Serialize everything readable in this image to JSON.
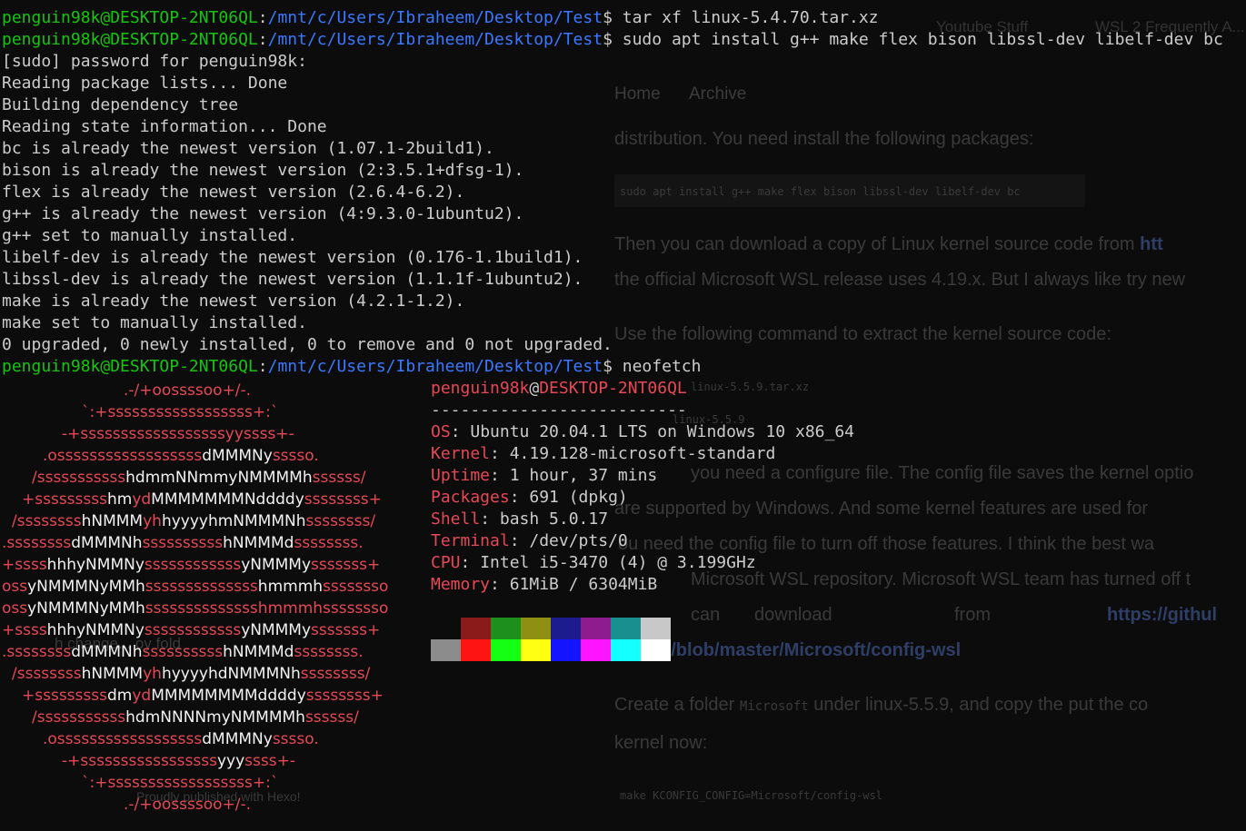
{
  "background_page": {
    "bookmarks": [
      "Youtube Stuff",
      "WSL 2 Frequently A..."
    ],
    "nav": [
      "Home",
      "Archive"
    ],
    "para1": "distribution. You need install the following packages:",
    "code1": "sudo apt install g++ make flex bison libssl-dev libelf-dev bc",
    "para2a": "Then you can download a copy of Linux kernel source code from",
    "para2a_link": "htt",
    "para2b": "the official Microsoft WSL release uses 4.19.x. But I always like try new",
    "para3": "Use the following command to extract the kernel source code:",
    "code2": "linux-5.5.9.tar.xz",
    "code3": "linux-5.5.9",
    "para4a": "you need a configure file. The config file saves the kernel optio",
    "para4b": "are supported by Windows. And some kernel features are used for",
    "para4c": "ou need the config file to turn off those features. I think the best wa",
    "para4d": "Microsoft WSL repository. Microsoft WSL team has turned off t",
    "para4e_1": "can",
    "para4e_2": "download",
    "para4e_3": "from",
    "para4e_4": "https://githul",
    "para4f": "Kernel/blob/master/Microsoft/config-wsl",
    "para5a": "Create a folder",
    "para5a_code": "Microsoft",
    "para5a_rest": "under linux-5.5.9, and copy the put the co",
    "para5b": "kernel now:",
    "code4": "make KCONFIG_CONFIG=Microsoft/config-wsl",
    "footer_left": "h change... oy fold",
    "footer": "Proudly published with Hexo!"
  },
  "terminal": {
    "prompt_user": "penguin98k@DESKTOP-2NT06QL",
    "prompt_path": "/mnt/c/Users/Ibraheem/Desktop/Test",
    "cmd1": " tar xf linux-5.4.70.tar.xz",
    "cmd2": " sudo apt install g++ make flex bison libssl-dev libelf-dev bc",
    "output": [
      "[sudo] password for penguin98k:",
      "Reading package lists... Done",
      "Building dependency tree",
      "Reading state information... Done",
      "bc is already the newest version (1.07.1-2build1).",
      "bison is already the newest version (2:3.5.1+dfsg-1).",
      "flex is already the newest version (2.6.4-6.2).",
      "g++ is already the newest version (4:9.3.0-1ubuntu2).",
      "g++ set to manually installed.",
      "libelf-dev is already the newest version (0.176-1.1build1).",
      "libssl-dev is already the newest version (1.1.1f-1ubuntu2).",
      "make is already the newest version (4.2.1-1.2).",
      "make set to manually installed.",
      "0 upgraded, 0 newly installed, 0 to remove and 0 not upgraded."
    ],
    "cmd3": " neofetch"
  },
  "neofetch": {
    "host_user": "penguin98k",
    "host_at": "@",
    "host_name": "DESKTOP-2NT06QL",
    "separator": "--------------------------",
    "info": [
      {
        "key": "OS",
        "value": ": Ubuntu 20.04.1 LTS on Windows 10 x86_64"
      },
      {
        "key": "Kernel",
        "value": ": 4.19.128-microsoft-standard"
      },
      {
        "key": "Uptime",
        "value": ": 1 hour, 37 mins"
      },
      {
        "key": "Packages",
        "value": ": 691 (dpkg)"
      },
      {
        "key": "Shell",
        "value": ": bash 5.0.17"
      },
      {
        "key": "Terminal",
        "value": ": /dev/pts/0"
      },
      {
        "key": "CPU",
        "value": ": Intel i5-3470 (4) @ 3.199GHz"
      },
      {
        "key": "Memory",
        "value": ": 61MiB / 6304MiB"
      }
    ],
    "logo": [
      [
        {
          "t": ".-/+oossssoo+/-.",
          "c": "r"
        }
      ],
      [
        {
          "t": "`:+ssssssssssssssssss+:`",
          "c": "r"
        }
      ],
      [
        {
          "t": "-+ssssssssssssssssssyyssss+-",
          "c": "r"
        }
      ],
      [
        {
          "t": ".ossssssssssssssssss",
          "c": "r"
        },
        {
          "t": "dMMMNy",
          "c": "w"
        },
        {
          "t": "sssso.",
          "c": "r"
        }
      ],
      [
        {
          "t": "/sssssssssss",
          "c": "r"
        },
        {
          "t": "hdmmNNmmyNMMMMh",
          "c": "w"
        },
        {
          "t": "ssssss/",
          "c": "r"
        }
      ],
      [
        {
          "t": "+sssssssss",
          "c": "r"
        },
        {
          "t": "hm",
          "c": "w"
        },
        {
          "t": "yd",
          "c": "r"
        },
        {
          "t": "MMMMMMMNddddy",
          "c": "w"
        },
        {
          "t": "ssssssss+",
          "c": "r"
        }
      ],
      [
        {
          "t": "/ssssssss",
          "c": "r"
        },
        {
          "t": "hNMMM",
          "c": "w"
        },
        {
          "t": "yh",
          "c": "r"
        },
        {
          "t": "hyyyyhmNMMMNh",
          "c": "w"
        },
        {
          "t": "ssssssss/",
          "c": "r"
        }
      ],
      [
        {
          "t": ".ssssssss",
          "c": "r"
        },
        {
          "t": "dMMMNh",
          "c": "w"
        },
        {
          "t": "ssssssssss",
          "c": "r"
        },
        {
          "t": "hNMMMd",
          "c": "w"
        },
        {
          "t": "ssssssss.",
          "c": "r"
        }
      ],
      [
        {
          "t": "+ssss",
          "c": "r"
        },
        {
          "t": "hhhyNMMNy",
          "c": "w"
        },
        {
          "t": "ssssssssssss",
          "c": "r"
        },
        {
          "t": "yNMMMy",
          "c": "w"
        },
        {
          "t": "sssssss+",
          "c": "r"
        }
      ],
      [
        {
          "t": "oss",
          "c": "r"
        },
        {
          "t": "yNMMMNyMMh",
          "c": "w"
        },
        {
          "t": "ssssssssssssss",
          "c": "r"
        },
        {
          "t": "hmmmh",
          "c": "w"
        },
        {
          "t": "ssssssso",
          "c": "r"
        }
      ],
      [
        {
          "t": "oss",
          "c": "r"
        },
        {
          "t": "yNMMMNyMMh",
          "c": "w"
        },
        {
          "t": "sssssssssssssshmmmhssssssso",
          "c": "r"
        }
      ],
      [
        {
          "t": "+ssss",
          "c": "r"
        },
        {
          "t": "hhhyNMMNy",
          "c": "w"
        },
        {
          "t": "ssssssssssss",
          "c": "r"
        },
        {
          "t": "yNMMMy",
          "c": "w"
        },
        {
          "t": "sssssss+",
          "c": "r"
        }
      ],
      [
        {
          "t": ".ssssssss",
          "c": "r"
        },
        {
          "t": "dMMMNh",
          "c": "w"
        },
        {
          "t": "ssssssssss",
          "c": "r"
        },
        {
          "t": "hNMMMd",
          "c": "w"
        },
        {
          "t": "ssssssss.",
          "c": "r"
        }
      ],
      [
        {
          "t": "/ssssssss",
          "c": "r"
        },
        {
          "t": "hNMMM",
          "c": "w"
        },
        {
          "t": "yh",
          "c": "r"
        },
        {
          "t": "hyyyyhdNMMMNh",
          "c": "w"
        },
        {
          "t": "ssssssss/",
          "c": "r"
        }
      ],
      [
        {
          "t": "+sssssssss",
          "c": "r"
        },
        {
          "t": "dm",
          "c": "w"
        },
        {
          "t": "yd",
          "c": "r"
        },
        {
          "t": "MMMMMMMMddddy",
          "c": "w"
        },
        {
          "t": "ssssssss+",
          "c": "r"
        }
      ],
      [
        {
          "t": "/sssssssssss",
          "c": "r"
        },
        {
          "t": "hdmNNNNmyNMMMMh",
          "c": "w"
        },
        {
          "t": "ssssss/",
          "c": "r"
        }
      ],
      [
        {
          "t": ".ossssssssssssssssss",
          "c": "r"
        },
        {
          "t": "dMMMNy",
          "c": "w"
        },
        {
          "t": "sssso.",
          "c": "r"
        }
      ],
      [
        {
          "t": "-+sssssssssssssssss",
          "c": "r"
        },
        {
          "t": "yyy",
          "c": "w"
        },
        {
          "t": "ssss+-",
          "c": "r"
        }
      ],
      [
        {
          "t": "`:+ssssssssssssssssss+:`",
          "c": "r"
        }
      ],
      [
        {
          "t": ".-/+oossssoo+/-.",
          "c": "r"
        }
      ]
    ],
    "logo_offsets": [
      136,
      90,
      68,
      47,
      35,
      24,
      13,
      2,
      2,
      2,
      2,
      2,
      2,
      13,
      24,
      35,
      47,
      68,
      90,
      136
    ],
    "palette_top": [
      "#0c0c0c",
      "#8b1a1a",
      "#1d8f1d",
      "#8f8f14",
      "#1c1c8f",
      "#8f1c8f",
      "#1a8f8f",
      "#c8c8c8"
    ],
    "palette_bottom": [
      "#8c8c8c",
      "#ff1414",
      "#14ff14",
      "#ffff14",
      "#1414ff",
      "#ff14ff",
      "#14ffff",
      "#ffffff"
    ]
  },
  "colors": {
    "prompt_user": "#16c60c",
    "prompt_path": "#3b78ff",
    "neofetch_red": "#e74856",
    "text": "#cccccc"
  }
}
